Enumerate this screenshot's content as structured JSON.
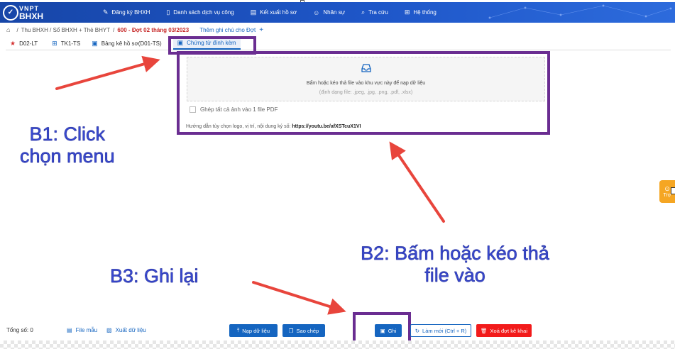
{
  "logo": {
    "line1": "VNPT",
    "line2": "BHXH"
  },
  "nav": [
    {
      "icon": "✎",
      "label": "Đăng ký BHXH"
    },
    {
      "icon": "▯",
      "label": "Danh sách dịch vụ công"
    },
    {
      "icon": "▤",
      "label": "Kết xuất hồ sơ"
    },
    {
      "icon": "☺",
      "label": "Nhân sự"
    },
    {
      "icon": "⌕",
      "label": "Tra cứu"
    },
    {
      "icon": "⊞",
      "label": "Hệ thống"
    }
  ],
  "breadcrumb": {
    "path": "Thu BHXH / Sổ BHXH + Thẻ BHYT",
    "current": "600 - Đợt 02 tháng 03/2023",
    "note": "Thêm ghi chú cho Đợt",
    "plus": "+"
  },
  "tabs": [
    {
      "icon": "★",
      "label": "D02-LT"
    },
    {
      "icon": "⊞",
      "label": "TK1-TS"
    },
    {
      "icon": "▣",
      "label": "Bảng kê hồ sơ(D01-TS)"
    },
    {
      "icon": "▣",
      "label": "Chứng từ đính kèm"
    }
  ],
  "upload": {
    "instruction": "Bấm hoặc kéo thả file vào khu vực này để nạp dữ liệu",
    "formats": "(định dạng file: .jpeg, .jpg, .png, .pdf, .xlsx)"
  },
  "merge_label": "Ghép tất cả ảnh vào 1 file PDF",
  "guide": {
    "text": "Hướng dẫn tùy chọn logo, vị trí, nội dung ký số:",
    "link": "https://youtu.be/afXSTcuX1VI"
  },
  "instructions": {
    "b1_line1": "B1: Click",
    "b1_line2": "chọn menu",
    "b2_line1": "B2: Bấm hoặc kéo thả",
    "b2_line2": "file vào",
    "b3": "B3: Ghi lại"
  },
  "side_widget": {
    "label": "Trợ"
  },
  "bottom": {
    "total": "Tổng số: 0",
    "file_template": "File mẫu",
    "export_data": "Xuất dữ liệu",
    "import_btn": "Nạp dữ liệu",
    "copy_btn": "Sao chép",
    "save_btn": "Ghi",
    "refresh_btn": "Làm mới (Ctrl + R)",
    "delete_btn": "Xoá đợt kê khai"
  },
  "colors": {
    "nav_bg": "#1e56c8",
    "highlight": "#6a2d91",
    "instruction_text": "#3949d0",
    "arrow": "#e8453c",
    "primary": "#1565c0",
    "danger": "#f21b1b"
  }
}
